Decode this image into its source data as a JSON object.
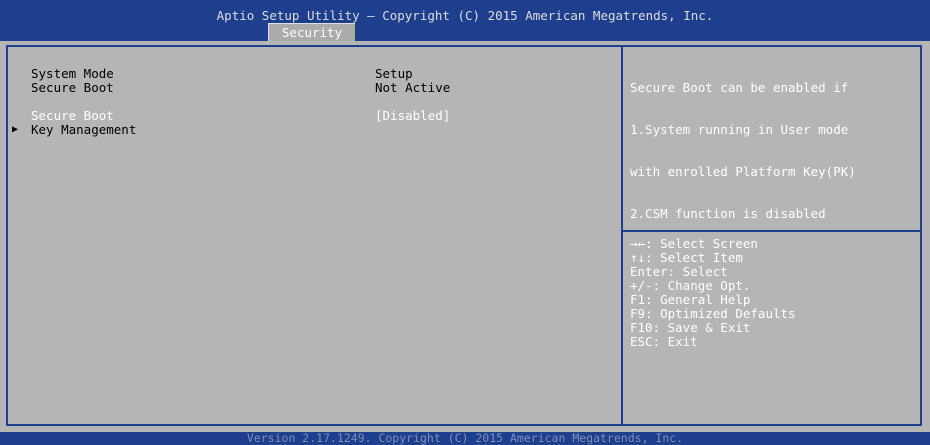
{
  "header": {
    "title": "Aptio Setup Utility – Copyright (C) 2015 American Megatrends, Inc.",
    "active_tab": "Security"
  },
  "settings": {
    "system_mode": {
      "label": "System Mode",
      "value": "Setup"
    },
    "secure_boot_state": {
      "label": "Secure Boot",
      "value": "Not Active"
    },
    "secure_boot_option": {
      "label": "Secure Boot",
      "value": "[Disabled]"
    },
    "key_management": {
      "label": "Key Management",
      "arrow": "▶"
    }
  },
  "help": {
    "text": "Secure Boot can be enabled if 1.System running in User mode with enrolled Platform Key(PK) 2.CSM function is disabled",
    "lines": [
      "Secure Boot can be enabled if",
      "1.System running in User mode",
      "with enrolled Platform Key(PK)",
      "2.CSM function is disabled"
    ]
  },
  "keys": [
    "→←: Select Screen",
    "↑↓: Select Item",
    "Enter: Select",
    "+/-: Change Opt.",
    "F1: General Help",
    "F9: Optimized Defaults",
    "F10: Save & Exit",
    "ESC: Exit"
  ],
  "footer": "Version 2.17.1249. Copyright (C) 2015 American Megatrends, Inc.",
  "colors": {
    "frame_blue": "#1e3f8e",
    "panel_gray": "#b5b5b5",
    "tab_gray": "#ababab",
    "highlight_white": "#ffffff"
  }
}
